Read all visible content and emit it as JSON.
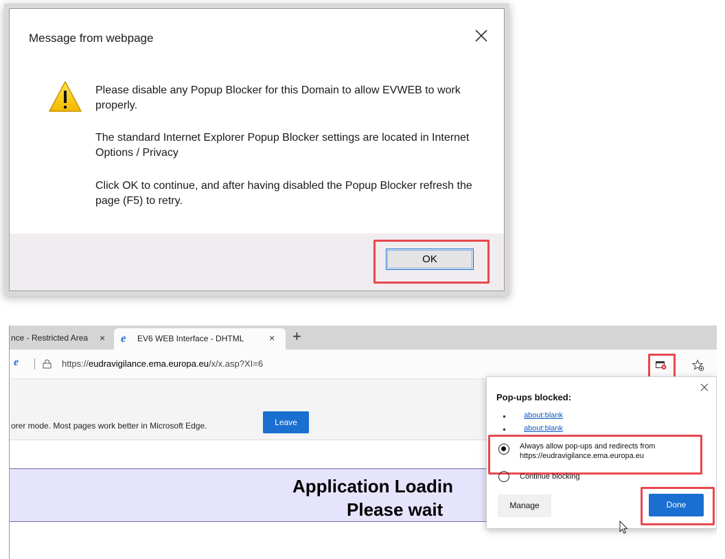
{
  "dialog": {
    "title": "Message from webpage",
    "message_1": "Please disable any Popup Blocker for this Domain to allow EVWEB to work properly.",
    "message_2": "The standard Internet Explorer Popup Blocker settings are located in Internet Options / Privacy",
    "message_3": "Click OK to continue, and after having disabled the Popup Blocker refresh the page (F5) to retry.",
    "ok_label": "OK",
    "icon": "warning-icon",
    "highlight_color": "#e8474d"
  },
  "browser": {
    "tabs": [
      {
        "label": "nce - Restricted Area",
        "close": "×"
      },
      {
        "label": "EV6 WEB Interface - DHTML",
        "close": "×",
        "icon": "ie-icon"
      }
    ],
    "new_tab": "+",
    "url_prefix": "https://",
    "url_host": "eudravigilance.ema.europa.eu",
    "url_path": "/x/x.asp?XI=6",
    "info_text": "orer mode. Most pages work better in Microsoft Edge.",
    "leave_label": "Leave",
    "loading_line_1": "Application Loadin",
    "loading_line_2": "Please wait",
    "accent_color": "#1a6fd0"
  },
  "flyout": {
    "title": "Pop-ups blocked:",
    "links": [
      "about:blank",
      "about:blank"
    ],
    "option_allow": "Always allow pop-ups and redirects from https://eudravigilance.ema.europa.eu",
    "option_block": "Continue blocking",
    "selected_option": "allow",
    "manage_label": "Manage",
    "done_label": "Done"
  }
}
